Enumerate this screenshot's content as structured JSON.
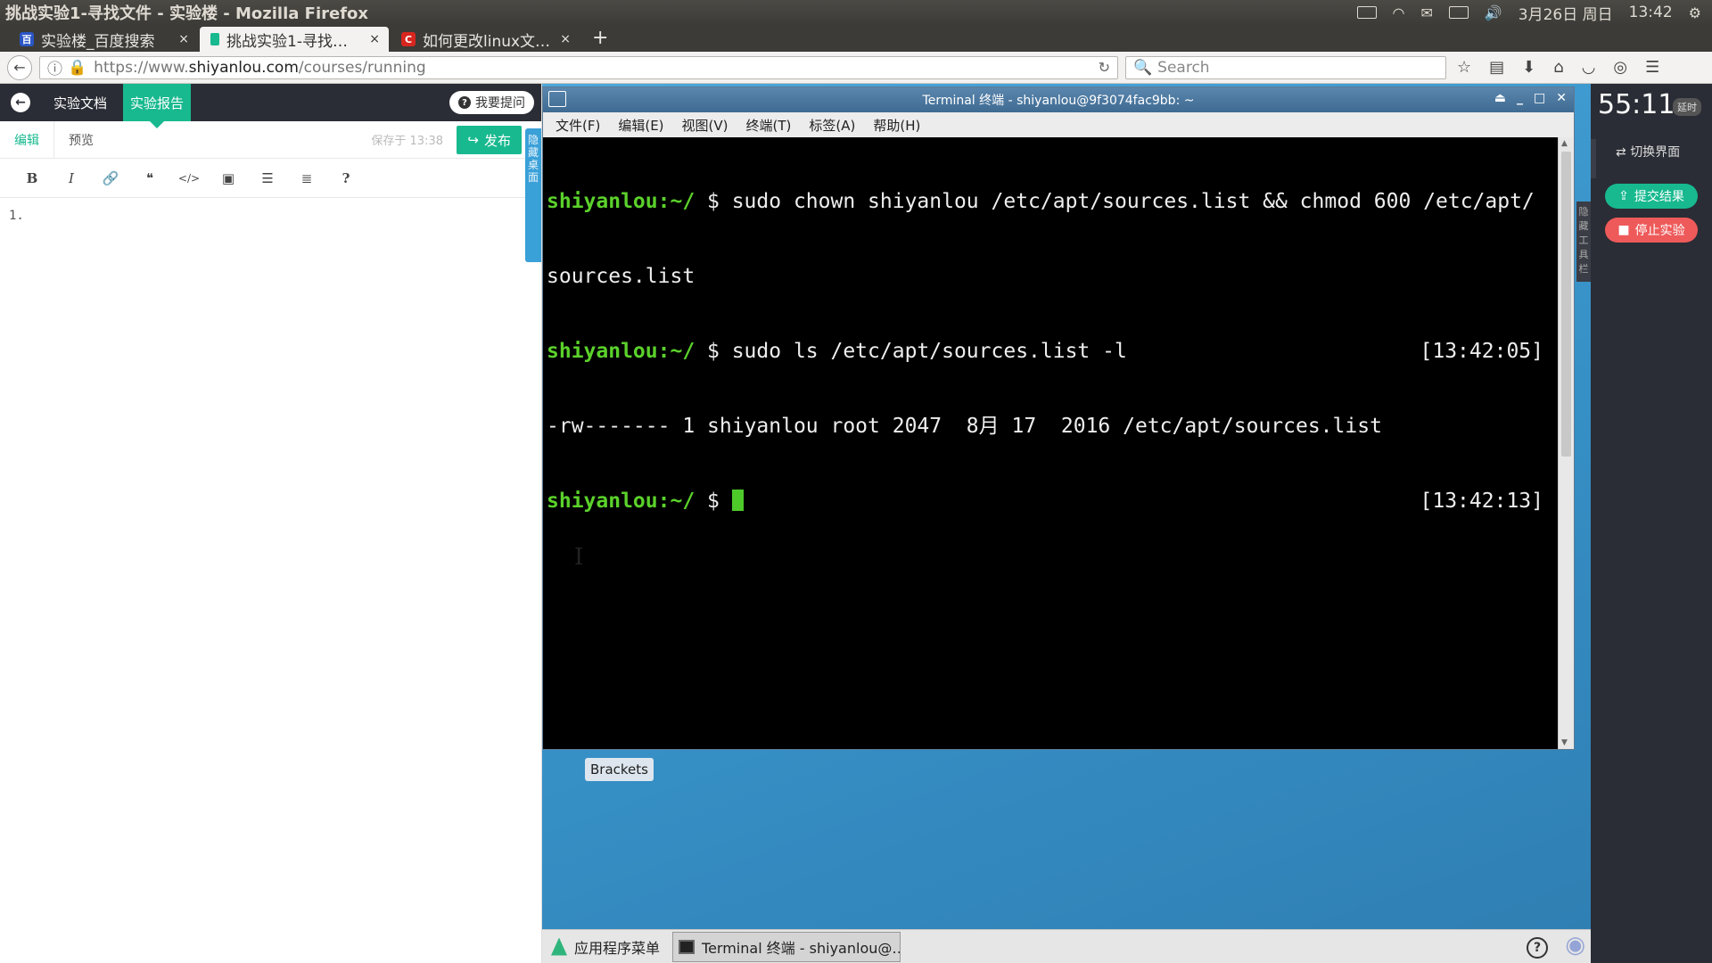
{
  "window": {
    "title": "挑战实验1-寻找文件 - 实验楼 - Mozilla Firefox"
  },
  "system_tray": {
    "date": "3月26日 周日",
    "time": "13:42"
  },
  "tabs": [
    {
      "label": "实验楼_百度搜索",
      "close": "×"
    },
    {
      "label": "挑战实验1-寻找…",
      "close": "×"
    },
    {
      "label": "如何更改linux文…",
      "close": "×"
    }
  ],
  "newtab": "+",
  "navbar": {
    "url_prefix": "https://www.",
    "url_host": "shiyanlou.com",
    "url_path": "/courses/running",
    "search_placeholder": "Search"
  },
  "left_panel": {
    "tab_docs": "实验文档",
    "tab_report": "实验报告",
    "ask_button": "我要提问",
    "sub_edit": "编辑",
    "sub_preview": "预览",
    "saved_text": "保存于 13:38",
    "publish_button": "发布",
    "hide_desktop": "隐藏桌面",
    "toolbar": [
      "B",
      "I",
      "🔗",
      "❝",
      "</>",
      "▣",
      "☰",
      "≣",
      "?"
    ],
    "editor_line": "1."
  },
  "terminal": {
    "title": "Terminal 终端 - shiyanlou@9f3074fac9bb: ~",
    "menu": [
      "文件(F)",
      "编辑(E)",
      "视图(V)",
      "终端(T)",
      "标签(A)",
      "帮助(H)"
    ],
    "lines": [
      {
        "prompt": "shiyanlou:~/",
        "cmd": " $ sudo chown shiyanlou /etc/apt/sources.list && chmod 600 /etc/apt/",
        "ts": ""
      },
      {
        "prompt": "",
        "cmd": "sources.list",
        "ts": ""
      },
      {
        "prompt": "shiyanlou:~/",
        "cmd": " $ sudo ls /etc/apt/sources.list -l",
        "ts": "[13:42:05]"
      },
      {
        "prompt": "",
        "cmd": "-rw------- 1 shiyanlou root 2047  8月 17  2016 /etc/apt/sources.list",
        "ts": ""
      },
      {
        "prompt": "shiyanlou:~/",
        "cmd": " $ ",
        "ts": "[13:42:13]"
      }
    ]
  },
  "desktop": {
    "icon_label": "Brackets"
  },
  "taskbar": {
    "app_menu": "应用程序菜单",
    "window_item": "Terminal 终端 - shiyanlou@…"
  },
  "right_panel": {
    "timer": "55:11",
    "delay_badge": "延时",
    "switch_ui": "切换界面",
    "submit_button": "提交结果",
    "stop_button": "停止实验",
    "hide_tools": "隐藏工具栏"
  },
  "colors": {
    "accent": "#18b98f",
    "stop": "#ee5a5a",
    "prompt": "#5bd12b"
  }
}
